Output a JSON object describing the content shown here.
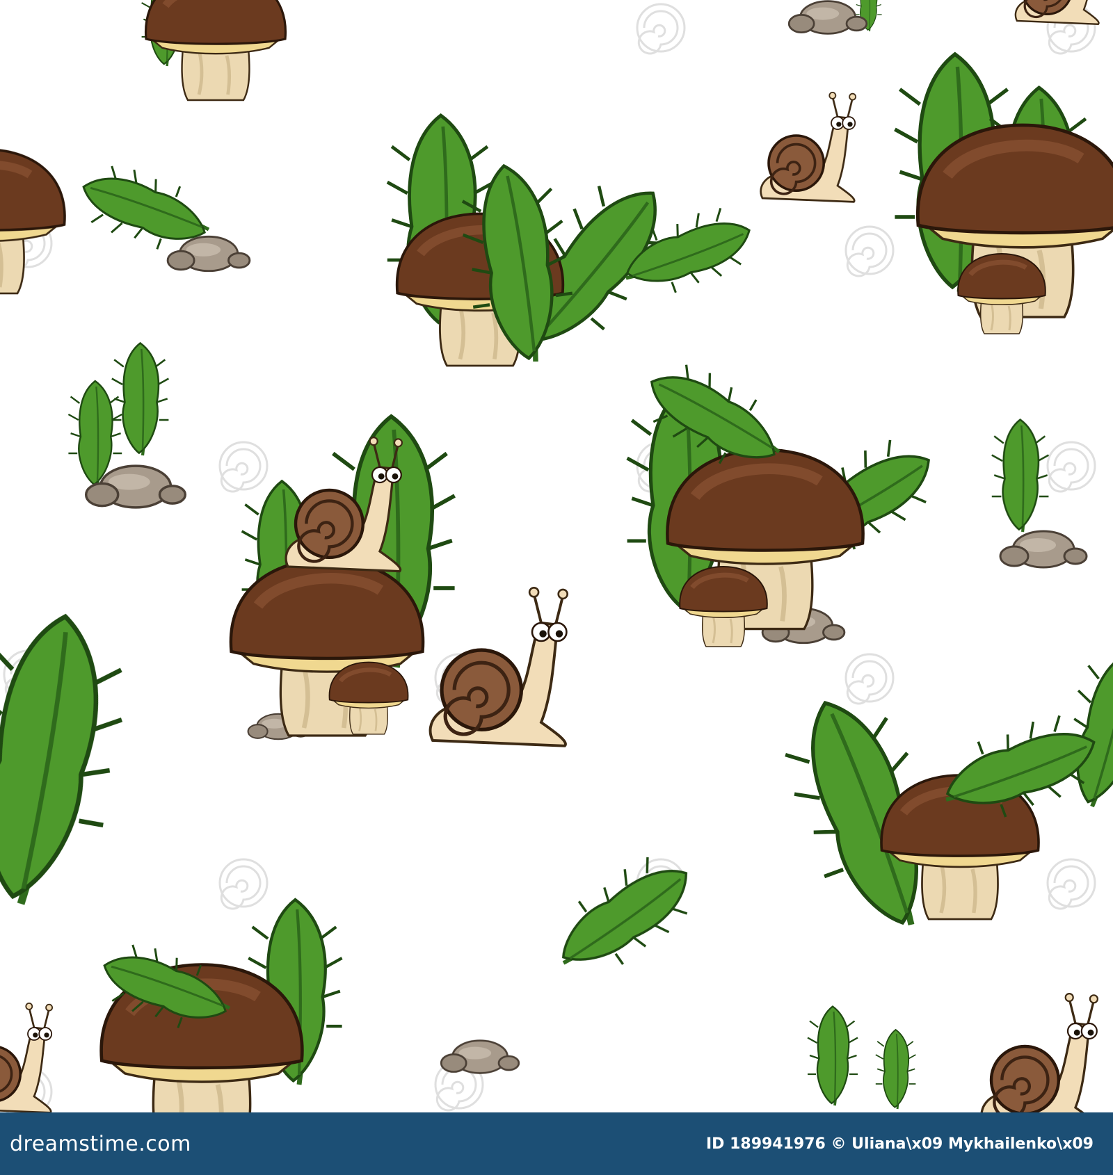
{
  "footer": {
    "brand": "dreamstime.com",
    "credit": "ID 189941976 © Uliana\\x09  Mykhailenko\\x09"
  },
  "artwork": {
    "pattern": "seamless",
    "motifs": [
      "mushroom-icon",
      "fern-icon",
      "snail-icon",
      "stone-icon",
      "watermark-spiral-icon"
    ],
    "colors": {
      "background": "#ffffff",
      "fern_green": "#4e9a2c",
      "fern_dark": "#2f6b1c",
      "cap_brown": "#6b3a1f",
      "cap_dark": "#4a2713",
      "stem_beige": "#ecd9b2",
      "gill_yellow": "#f0d890",
      "stone_gray": "#a89b8c",
      "snail_body": "#f2ddb8",
      "shell_brown": "#8a5a3b",
      "footer_blue": "#1c4f75"
    }
  }
}
